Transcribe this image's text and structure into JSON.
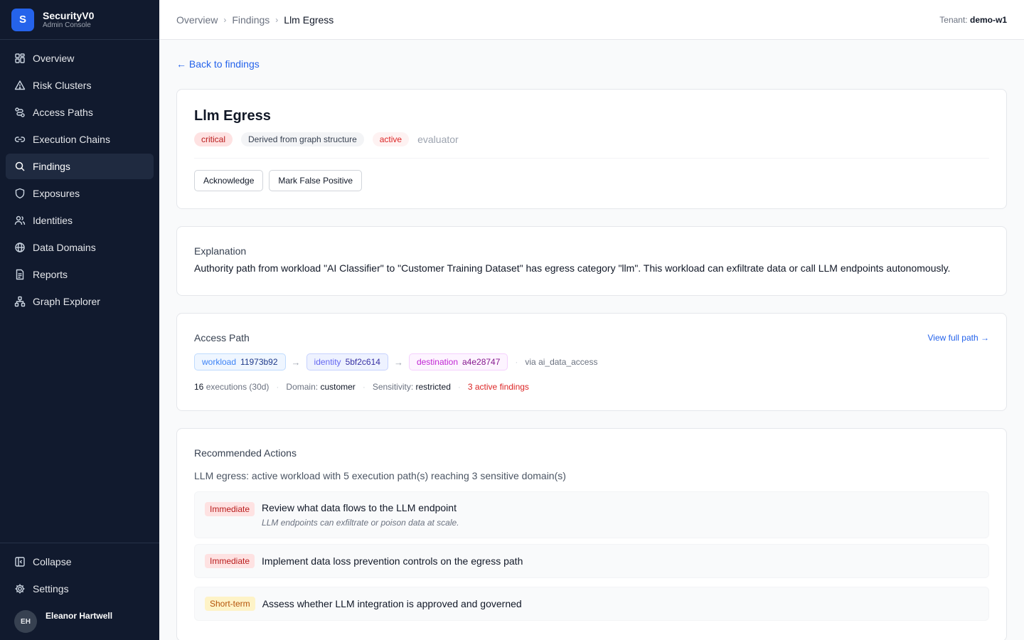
{
  "brand": {
    "logo_letter": "S",
    "name": "SecurityV0",
    "subtitle": "Admin Console"
  },
  "sidebar": {
    "items": [
      {
        "label": "Overview",
        "icon": "grid-icon",
        "active": false
      },
      {
        "label": "Risk Clusters",
        "icon": "warning-triangle-icon",
        "active": false
      },
      {
        "label": "Access Paths",
        "icon": "route-icon",
        "active": false
      },
      {
        "label": "Execution Chains",
        "icon": "link-icon",
        "active": false
      },
      {
        "label": "Findings",
        "icon": "search-icon",
        "active": true
      },
      {
        "label": "Exposures",
        "icon": "shield-icon",
        "active": false
      },
      {
        "label": "Identities",
        "icon": "users-icon",
        "active": false
      },
      {
        "label": "Data Domains",
        "icon": "globe-icon",
        "active": false
      },
      {
        "label": "Reports",
        "icon": "document-icon",
        "active": false
      },
      {
        "label": "Graph Explorer",
        "icon": "network-icon",
        "active": false
      }
    ],
    "collapse_label": "Collapse",
    "settings_label": "Settings",
    "user": {
      "initials": "EH",
      "name": "Eleanor Hartwell"
    }
  },
  "header": {
    "breadcrumb": [
      "Overview",
      "Findings",
      "Llm Egress"
    ],
    "tenant_label": "Tenant:",
    "tenant_value": "demo-w1"
  },
  "back_link": "← Back to findings",
  "finding": {
    "title": "Llm Egress",
    "severity": "critical",
    "origin": "Derived from graph structure",
    "status": "active",
    "source": "evaluator",
    "actions": {
      "acknowledge": "Acknowledge",
      "false_positive": "Mark False Positive"
    }
  },
  "explanation": {
    "title": "Explanation",
    "text": "Authority path from workload \"AI Classifier\" to \"Customer Training Dataset\" has egress category \"llm\". This workload can exfiltrate data or call LLM endpoints autonomously."
  },
  "access_path": {
    "title": "Access Path",
    "view_full": "View full path →",
    "nodes": [
      {
        "type": "workload",
        "id": "11973b92"
      },
      {
        "type": "identity",
        "id": "5bf2c614"
      },
      {
        "type": "destination",
        "id": "a4e28747"
      }
    ],
    "via": "via ai_data_access",
    "executions_count": "16",
    "executions_label": "executions (30d)",
    "domain_label": "Domain:",
    "domain_value": "customer",
    "sensitivity_label": "Sensitivity:",
    "sensitivity_value": "restricted",
    "active_findings": "3 active findings"
  },
  "recommended": {
    "title": "Recommended Actions",
    "summary": "LLM egress: active workload with 5 execution path(s) reaching 3 sensitive domain(s)",
    "items": [
      {
        "priority": "Immediate",
        "title": "Review what data flows to the LLM endpoint",
        "description": "LLM endpoints can exfiltrate or poison data at scale."
      },
      {
        "priority": "Immediate",
        "title": "Implement data loss prevention controls on the egress path",
        "description": ""
      },
      {
        "priority": "Short-term",
        "title": "Assess whether LLM integration is approved and governed",
        "description": ""
      }
    ]
  },
  "colors": {
    "sidebar_bg": "#111a2e",
    "accent": "#2563eb",
    "critical": "#b91c1c"
  }
}
